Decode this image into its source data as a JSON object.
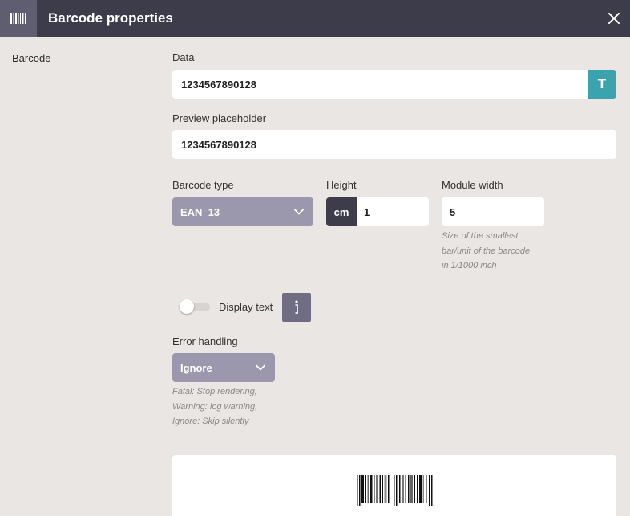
{
  "header": {
    "title": "Barcode properties",
    "icon": "barcode-icon",
    "close_icon": "close-icon"
  },
  "sidebar": {
    "section_label": "Barcode"
  },
  "form": {
    "data": {
      "label": "Data",
      "value": "1234567890128",
      "insert_button_label": "T"
    },
    "preview_placeholder": {
      "label": "Preview placeholder",
      "value": "1234567890128"
    },
    "barcode_type": {
      "label": "Barcode type",
      "selected": "EAN_13"
    },
    "height": {
      "label": "Height",
      "unit": "cm",
      "value": "1"
    },
    "module_width": {
      "label": "Module width",
      "value": "5",
      "hint_lines": [
        "Size of the smallest",
        "bar/unit of the barcode",
        "in 1/1000 inch"
      ]
    },
    "display_text": {
      "label": "Display text",
      "enabled": false,
      "info_icon": "info-icon"
    },
    "error_handling": {
      "label": "Error handling",
      "selected": "Ignore",
      "hint_lines": [
        "Fatal: Stop rendering,",
        "Warning: log warning,",
        "Ignore: Skip silently"
      ]
    }
  },
  "colors": {
    "header_bg": "#3d3c4b",
    "accent": "#3aa3ad",
    "select_bg": "#9b98ad",
    "page_bg": "#e9e6e3"
  }
}
